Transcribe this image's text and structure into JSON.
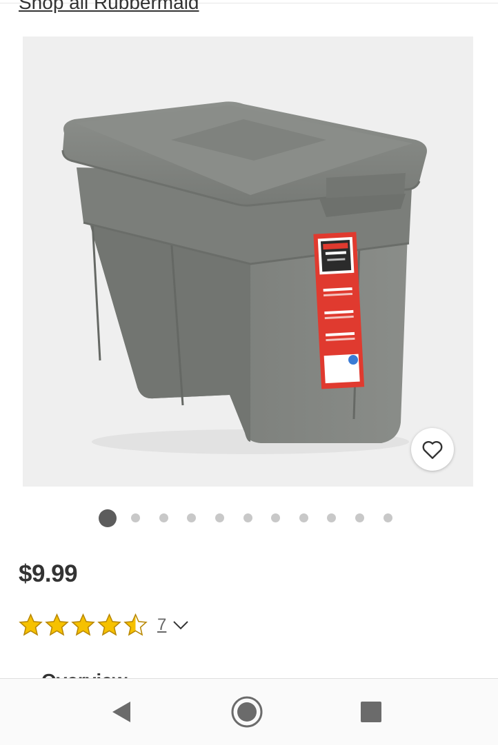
{
  "header": {
    "shop_link": "Shop all Rubbermaid"
  },
  "product": {
    "price": "$9.99",
    "rating_value": 4.5,
    "rating_max": 5,
    "review_count": "7",
    "favorite_icon": "heart-outline-icon",
    "label_brand": "Rubbermaid",
    "label_line": "ROUGHNECK",
    "label_tagline": "BUILT TO LAST",
    "label_features": [
      "LIFETIME WARRANTY",
      "COLD WEATHER RESISTANT",
      "SNAP TIGHT LID"
    ]
  },
  "gallery": {
    "image_count": 11,
    "active_index": 0
  },
  "next_section_peek": "Overview",
  "colors": {
    "star": "#f6c100",
    "star_outline": "#b88700",
    "dot_active": "#5c5c5c",
    "dot_inactive": "#c8c8c8",
    "tote_gray": "#7c7f7b",
    "label_red": "#e03a2f"
  },
  "system_nav": {
    "back_icon": "back-triangle-icon",
    "home_icon": "home-circle-icon",
    "recents_icon": "recents-square-icon"
  }
}
